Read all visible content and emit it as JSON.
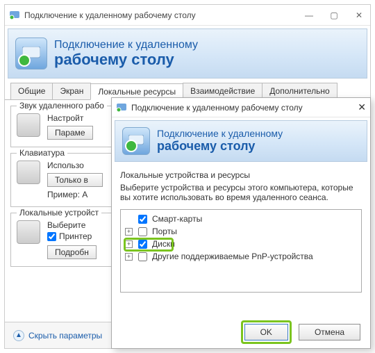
{
  "main": {
    "title": "Подключение к удаленному рабочему столу",
    "banner": {
      "line1": "Подключение к удаленному",
      "line2": "рабочему столу"
    },
    "tabs": [
      "Общие",
      "Экран",
      "Локальные ресурсы",
      "Взаимодействие",
      "Дополнительно"
    ],
    "active_tab": 2,
    "groups": {
      "audio": {
        "title": "Звук удаленного рабо",
        "line": "Настройт",
        "button": "Параме"
      },
      "keyboard": {
        "title": "Клавиатура",
        "line": "Использо",
        "button": "Только в",
        "example": "Пример: A"
      },
      "devices": {
        "title": "Локальные устройст",
        "line": "Выберите",
        "printers": "Принтер",
        "button": "Подробн"
      }
    },
    "footer": {
      "collapse": "Скрыть параметры"
    }
  },
  "dialog": {
    "title": "Подключение к удаленному рабочему столу",
    "banner": {
      "line1": "Подключение к удаленному",
      "line2": "рабочему столу"
    },
    "section_header": "Локальные устройства и ресурсы",
    "description": "Выберите устройства и ресурсы этого компьютера, которые вы хотите использовать во время удаленного сеанса.",
    "tree": {
      "items": [
        {
          "label": "Смарт-карты",
          "checked": true,
          "expandable": false
        },
        {
          "label": "Порты",
          "checked": false,
          "expandable": true
        },
        {
          "label": "Диски",
          "checked": true,
          "expandable": true
        },
        {
          "label": "Другие поддерживаемые PnP-устройства",
          "checked": false,
          "expandable": true
        }
      ]
    },
    "buttons": {
      "ok": "OK",
      "cancel": "Отмена"
    }
  }
}
